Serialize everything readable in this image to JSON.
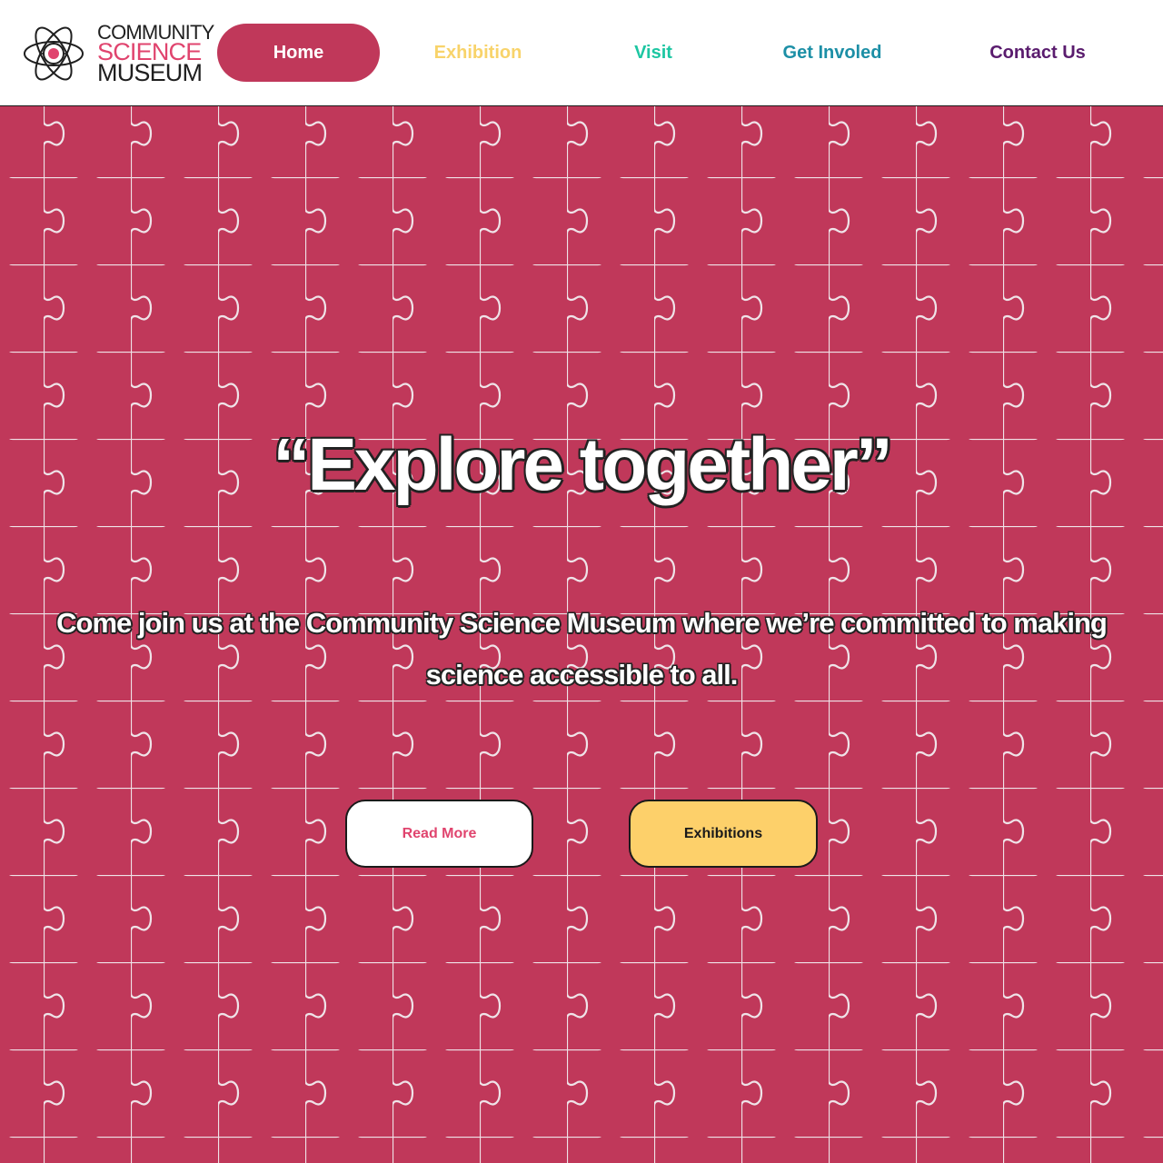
{
  "brand": {
    "line1": "Community",
    "line2": "Science",
    "line3": "Museum",
    "accent_color": "#e0446e",
    "logo_icon": "atom-icon"
  },
  "nav": {
    "items": [
      {
        "label": "Home",
        "color": "#ffffff",
        "active": true
      },
      {
        "label": "Exhibition",
        "color": "#f8d36a"
      },
      {
        "label": "Visit",
        "color": "#1cc6a2"
      },
      {
        "label": "Get Involed",
        "color": "#1c8fa6"
      },
      {
        "label": "Contact Us",
        "color": "#5a1c6e"
      }
    ]
  },
  "hero": {
    "title": "“Explore together”",
    "subtitle": "Come join us at the Community Science Museum where we’re committed to making science accessible to all.",
    "background_color": "#c0385a",
    "pattern": "puzzle-pattern",
    "buttons": {
      "read_more": "Read More",
      "exhibitions": "Exhibitions"
    }
  }
}
